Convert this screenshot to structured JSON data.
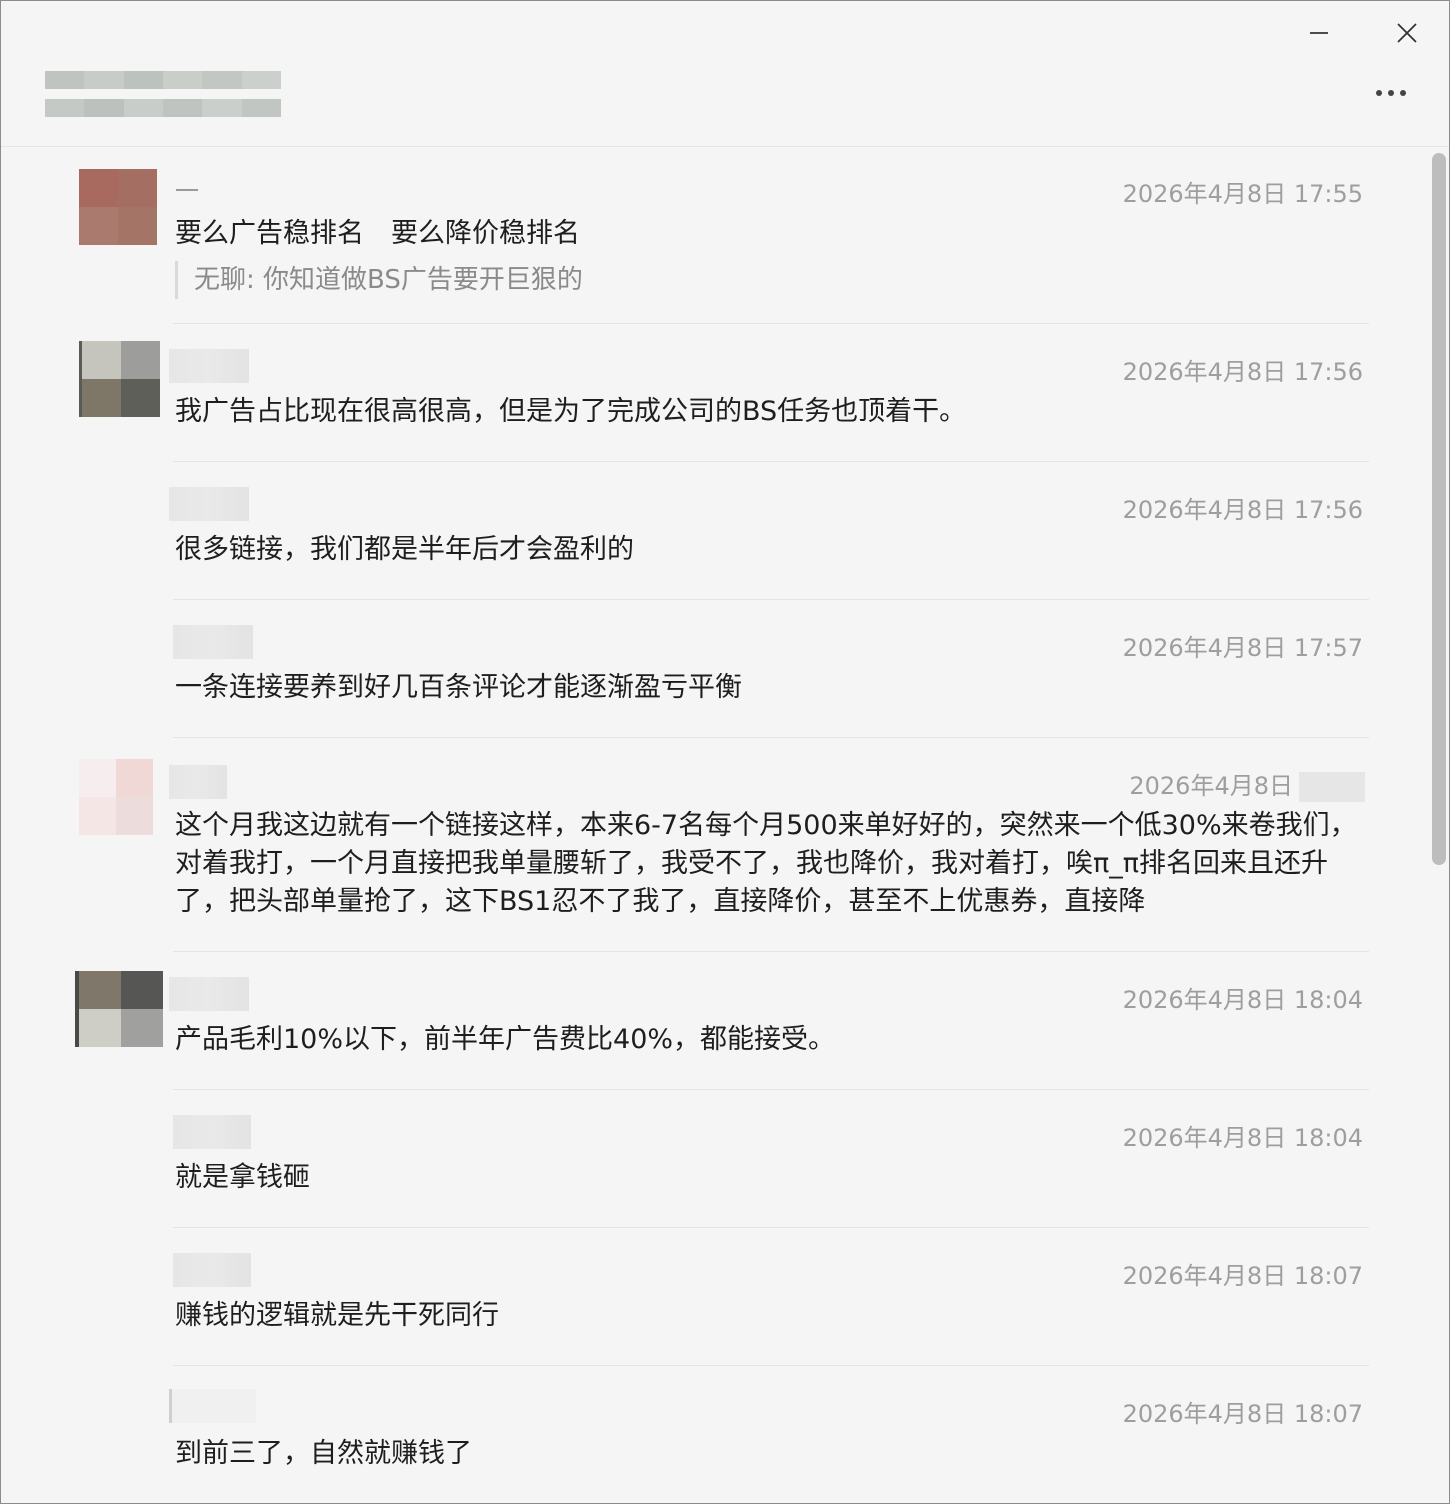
{
  "window": {
    "controls": {
      "minimize": "minimize-icon",
      "close": "close-icon",
      "more": "more-icon"
    }
  },
  "messages": [
    {
      "name": "一",
      "time": "2026年4月8日 17:55",
      "text": "要么广告稳排名　要么降价稳排名",
      "quote": "无聊: 你知道做BS广告要开巨狠的"
    },
    {
      "name": "",
      "time": "2026年4月8日 17:56",
      "text": "我广告占比现在很高很高，但是为了完成公司的BS任务也顶着干。"
    },
    {
      "name": "",
      "time": "2026年4月8日 17:56",
      "text": "很多链接，我们都是半年后才会盈利的"
    },
    {
      "name": "",
      "time": "2026年4月8日 17:57",
      "text": "一条连接要养到好几百条评论才能逐渐盈亏平衡"
    },
    {
      "name": "",
      "time": "2026年4月8日",
      "text": "这个月我这边就有一个链接这样，本来6-7名每个月500来单好好的，突然来一个低30%来卷我们，对着我打，一个月直接把我单量腰斩了，我受不了，我也降价，我对着打，唉π_π排名回来且还升了，把头部单量抢了，这下BS1忍不了我了，直接降价，甚至不上优惠券，直接降"
    },
    {
      "name": "",
      "time": "2026年4月8日 18:04",
      "text": "产品毛利10%以下，前半年广告费比40%，都能接受。"
    },
    {
      "name": "",
      "time": "2026年4月8日 18:04",
      "text": "就是拿钱砸"
    },
    {
      "name": "",
      "time": "2026年4月8日 18:07",
      "text": "赚钱的逻辑就是先干死同行"
    },
    {
      "name": "",
      "time": "2026年4月8日 18:07",
      "text": "到前三了，自然就赚钱了"
    }
  ]
}
